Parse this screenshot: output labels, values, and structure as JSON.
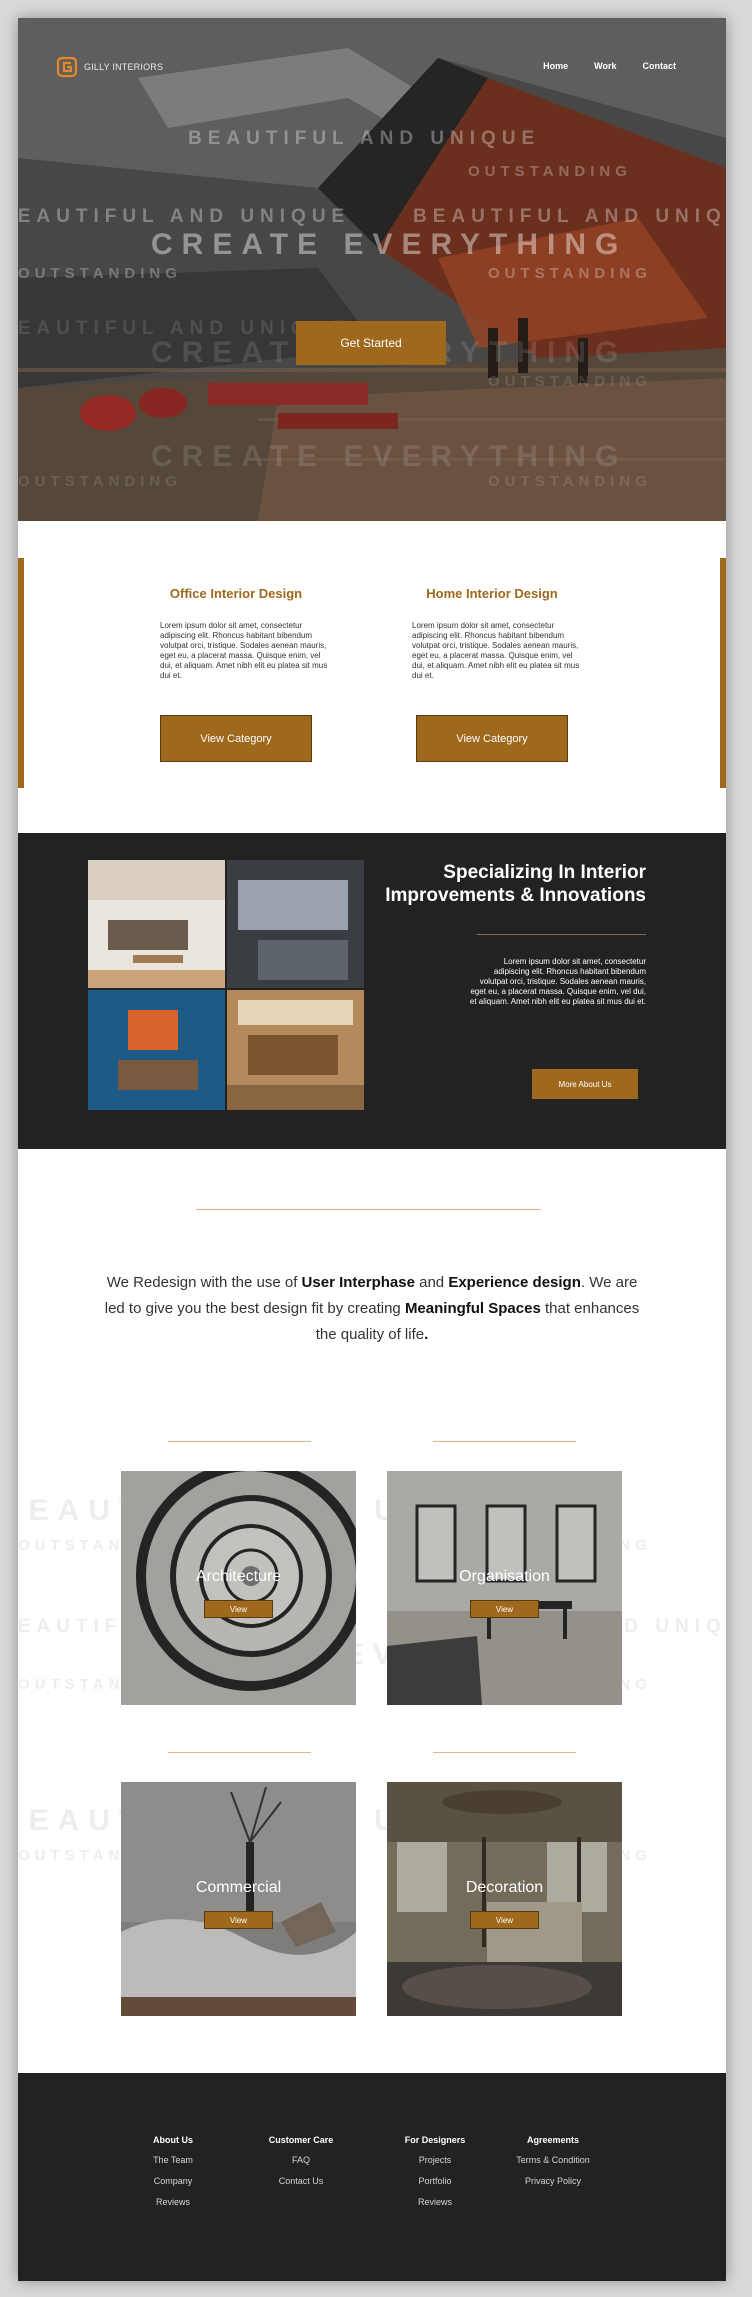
{
  "brand": {
    "name": "GILLY INTERIORS"
  },
  "nav": {
    "items": [
      "Home",
      "Work",
      "Contact"
    ]
  },
  "hero": {
    "watermarks": [
      "BEAUTIFUL AND UNIQUE",
      "CREATE EVERYTHING",
      "OUTSTANDING"
    ],
    "cta_label": "Get Started"
  },
  "categories": [
    {
      "title": "Office Interior Design",
      "text": "Lorem ipsum dolor sit amet, consectetur adipiscing elit. Rhoncus habitant bibendum volutpat orci, tristique. Sodales aenean mauris, eget eu, a placerat massa. Quisque enim, vel dui, et aliquam. Amet nibh elit eu platea sit mus dui et.",
      "button": "View Category"
    },
    {
      "title": "Home Interior Design",
      "text": "Lorem ipsum dolor sit amet, consectetur adipiscing elit. Rhoncus habitant bibendum volutpat orci, tristique. Sodales aenean mauris, eget eu, a placerat massa. Quisque enim, vel dui, et aliquam. Amet nibh elit eu platea sit mus dui et.",
      "button": "View Category"
    }
  ],
  "specializing": {
    "title": "Specializing In Interior Improvements & Innovations",
    "text": "Lorem ipsum dolor sit amet, consectetur adipiscing elit. Rhoncus habitant bibendum volutpat orci, tristique. Sodales aenean mauris, eget eu, a placerat massa. Quisque enim, vel dui, et aliquam. Amet nibh elit eu platea sit mus dui et.",
    "button": "More About Us"
  },
  "redesign": {
    "p1": "We Redesign with the use of ",
    "b1": "User Interphase",
    "p2": " and ",
    "b2": "Experience design",
    "p3": ". We are led to give you the best design fit by creating ",
    "b3": "Meaningful Spaces",
    "p4": " that enhances the quality of life",
    "b4": "."
  },
  "cards": [
    {
      "title": "Architecture",
      "button": "View"
    },
    {
      "title": "Organisation",
      "button": "View"
    },
    {
      "title": "Commercial",
      "button": "View"
    },
    {
      "title": "Decoration",
      "button": "View"
    }
  ],
  "footer": {
    "columns": [
      {
        "heading": "About Us",
        "links": [
          "The Team",
          "Company",
          "Reviews"
        ]
      },
      {
        "heading": "Customer Care",
        "links": [
          "FAQ",
          "Contact Us"
        ]
      },
      {
        "heading": "For Designers",
        "links": [
          "Projects",
          "Portfolio",
          "Reviews"
        ]
      },
      {
        "heading": "Agreements",
        "links": [
          "Terms & Condition",
          "Privacy Policy"
        ]
      }
    ]
  },
  "colors": {
    "accent": "#9e681d",
    "dark": "#222222",
    "rule": "#e7b58c"
  }
}
